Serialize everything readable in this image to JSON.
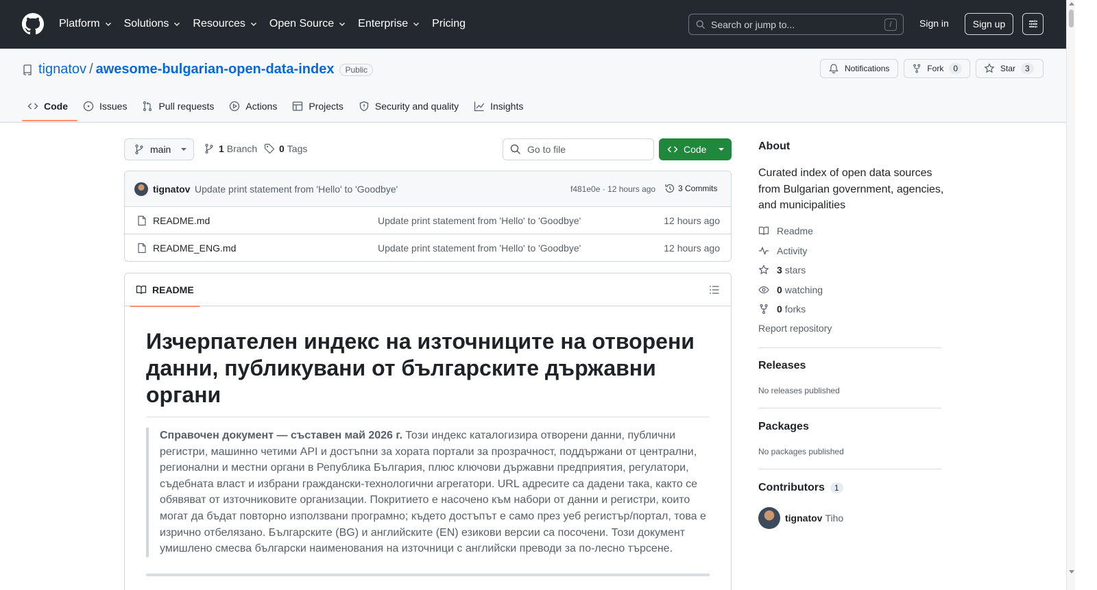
{
  "header": {
    "nav": [
      {
        "label": "Platform",
        "dropdown": true
      },
      {
        "label": "Solutions",
        "dropdown": true
      },
      {
        "label": "Resources",
        "dropdown": true
      },
      {
        "label": "Open Source",
        "dropdown": true
      },
      {
        "label": "Enterprise",
        "dropdown": true
      },
      {
        "label": "Pricing",
        "dropdown": false
      }
    ],
    "search_placeholder": "Search or jump to...",
    "search_key": "/",
    "sign_in": "Sign in",
    "sign_up": "Sign up"
  },
  "repo": {
    "owner": "tignatov",
    "separator": "/",
    "name": "awesome-bulgarian-open-data-index",
    "visibility": "Public",
    "notifications_label": "Notifications",
    "fork_label": "Fork",
    "fork_count": "0",
    "star_label": "Star",
    "star_count": "3"
  },
  "tabs": [
    {
      "label": "Code",
      "icon": "code-icon",
      "active": true
    },
    {
      "label": "Issues",
      "icon": "issue-icon",
      "active": false
    },
    {
      "label": "Pull requests",
      "icon": "pull-request-icon",
      "active": false
    },
    {
      "label": "Actions",
      "icon": "play-icon",
      "active": false
    },
    {
      "label": "Projects",
      "icon": "table-icon",
      "active": false
    },
    {
      "label": "Security and quality",
      "icon": "shield-icon",
      "active": false
    },
    {
      "label": "Insights",
      "icon": "graph-icon",
      "active": false
    }
  ],
  "toolbar": {
    "branch": "main",
    "branch_count": "1",
    "branch_label": "Branch",
    "tag_count": "0",
    "tag_label": "Tags",
    "goto_placeholder": "Go to file",
    "code_label": "Code"
  },
  "latest_commit": {
    "author": "tignatov",
    "message": "Update print statement from 'Hello' to 'Goodbye'",
    "meta": "f481e0e · 12 hours ago",
    "commits": "3 Commits"
  },
  "files": [
    {
      "name": "README.md",
      "message": "Update print statement from 'Hello' to 'Goodbye'",
      "time": "12 hours ago"
    },
    {
      "name": "README_ENG.md",
      "message": "Update print statement from 'Hello' to 'Goodbye'",
      "time": "12 hours ago"
    }
  ],
  "readme": {
    "tab_label": "README",
    "heading": "Изчерпателен индекс на източниците на отворени данни, публикувани от българските държавни органи",
    "quote_bold": "Справочен документ — съставен май 2026 г.",
    "quote_text": " Този индекс каталогизира отворени данни, публични регистри, машинно четими API и достъпни за хората портали за прозрачност, поддържани от централни, регионални и местни органи в Република България, плюс ключови държавни предприятия, регулатори, съдебната власт и избрани граждански-технологични агрегатори. URL адресите са дадени така, както се обявяват от източниковите организации. Покритието е насочено към набори от данни и регистри, които могат да бъдат повторно използвани програмно; където достъпът е само през уеб регистър/портал, това е изрично отбелязано. Българските (BG) и английските (EN) езикови версии са посочени. Този документ умишлено смесва български наименования на източници с английски преводи за по-лесно търсене."
  },
  "sidebar": {
    "about_title": "About",
    "description": "Curated index of open data sources from Bulgarian government, agencies, and municipalities",
    "links": [
      {
        "icon": "book-icon",
        "count": "",
        "label": "Readme"
      },
      {
        "icon": "pulse-icon",
        "count": "",
        "label": "Activity"
      },
      {
        "icon": "star-icon",
        "count": "3",
        "label": "stars"
      },
      {
        "icon": "eye-icon",
        "count": "0",
        "label": "watching"
      },
      {
        "icon": "fork-icon",
        "count": "0",
        "label": "forks"
      }
    ],
    "report": "Report repository",
    "releases_title": "Releases",
    "releases_sub": "No releases published",
    "packages_title": "Packages",
    "packages_sub": "No packages published",
    "contributors_title": "Contributors",
    "contributors_count": "1",
    "contributor_login": "tignatov",
    "contributor_name": "Tiho"
  }
}
